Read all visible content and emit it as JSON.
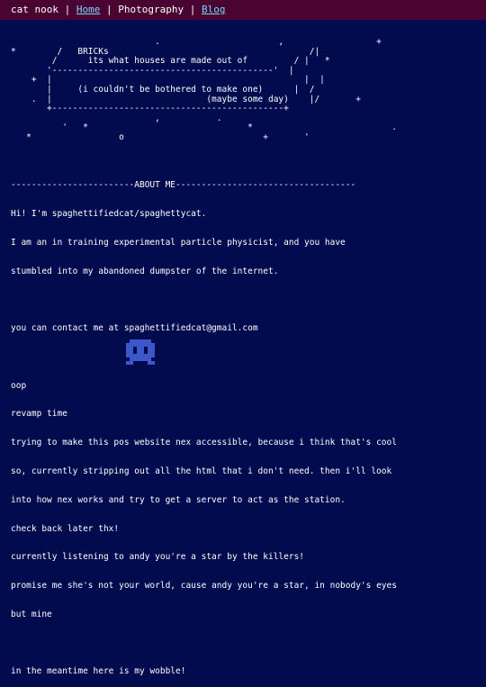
{
  "nav": {
    "site_name": "cat nook",
    "separator": "|",
    "links": [
      {
        "label": "Home"
      },
      {
        "label": "Photography"
      },
      {
        "label": "Blog"
      }
    ]
  },
  "ascii_art": "                            .                       ,                  +\n*        /   BRICKs                                       /|\n        /      its what houses are made out of         / |   *\n       '-------------------------------------------'  |\n    +  |                                                 |  |\n       |     (i couldn't be bothered to make one)      |  /\n    .  |                              (maybe some day)    |/       +\n       +---------------------------------------------+\n                            ,           .\n          '   *                               *                           .\n   *                 o                           +       '",
  "about": {
    "heading_line": "------------------------ABOUT ME-----------------------------------",
    "lines": [
      "Hi! I'm spaghettifiedcat/spaghettycat.",
      "I am an in training experimental particle physicist, and you have",
      "stumbled into my abandoned dumpster of the internet.",
      "",
      "you can contact me at spaghettifiedcat@gmail.com",
      "",
      "oop",
      "revamp time",
      "trying to make this pos website nex accessible, because i think that's cool",
      "so, currently stripping out all the html that i don't need. then i'll look",
      "into how nex works and try to get a server to act as the station.",
      "check back later thx!",
      "currently listening to andy you're a star by the killers!",
      "promise me she's not your world, cause andy you're a star, in nobody's eyes",
      "but mine",
      "",
      "in the meantime here is my wobble!"
    ]
  },
  "mascot_icon": "pixel-wobble-icon",
  "colors": {
    "background": "#020b4e",
    "topbar": "#4a0431",
    "link": "#7ad3ff",
    "mascot": "#3b57c9"
  }
}
